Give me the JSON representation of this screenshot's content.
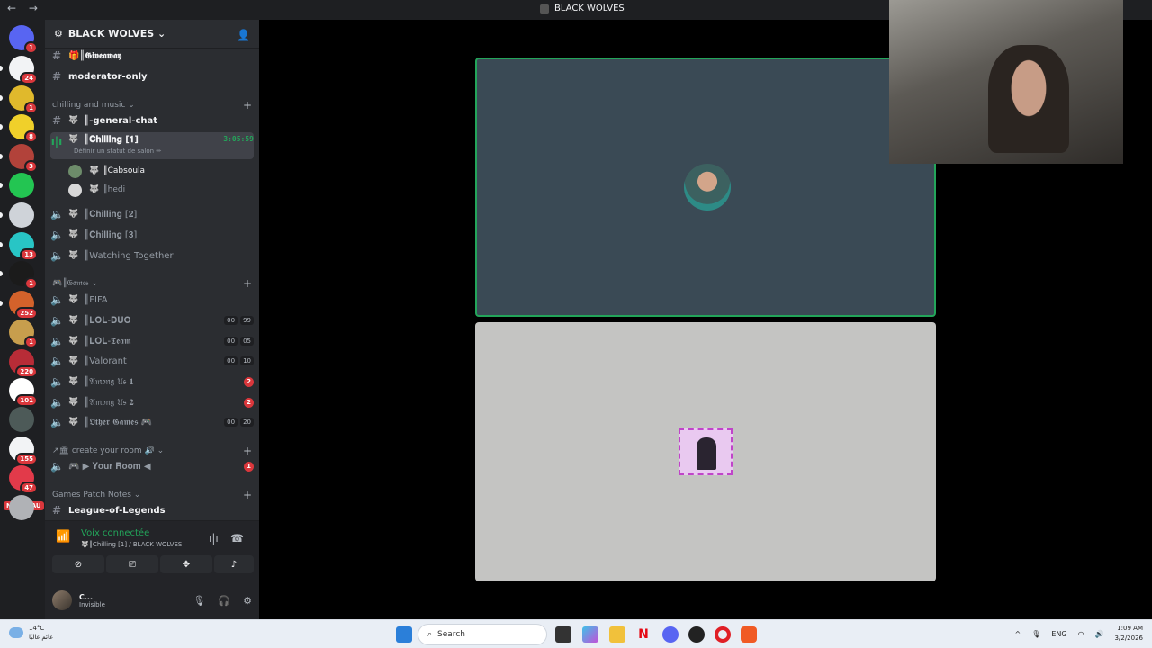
{
  "window": {
    "title": "BLACK WOLVES",
    "back": "←",
    "forward": "→"
  },
  "server": {
    "name": "BLACK WOLVES ⌄"
  },
  "guilds": [
    {
      "badge": "1",
      "color": "#5865f2"
    },
    {
      "badge": "24",
      "color": "#f2f3f5"
    },
    {
      "badge": "1",
      "color": "#e0b92c"
    },
    {
      "badge": "8",
      "color": "#f0d02a"
    },
    {
      "badge": "3",
      "color": "#b2423a"
    },
    {
      "badge": "",
      "color": "#23c552"
    },
    {
      "badge": "",
      "color": "#cfd3d9"
    },
    {
      "badge": "13",
      "color": "#28c5c5"
    },
    {
      "badge": "1",
      "color": "#1b1b1b"
    },
    {
      "badge": "252",
      "color": "#d3622b"
    },
    {
      "badge": "1",
      "color": "#c79e4d"
    },
    {
      "badge": "220",
      "color": "#b82c37"
    },
    {
      "badge": "101",
      "color": "#ffffff"
    },
    {
      "badge": "",
      "color": "#4d5a58"
    },
    {
      "badge": "155",
      "color": "#f2f3f5"
    },
    {
      "badge": "47",
      "color": "#e23a4a"
    },
    {
      "badge": "",
      "color": "#b0b2b6"
    }
  ],
  "new_label": "NOUVEAU",
  "channels": {
    "giveaway": "🎁║𝕲𝖎𝖛𝖊𝖆𝖜𝖆𝖞",
    "moderator": "moderator-only",
    "cat_chill": "chilling and music ⌄",
    "general": "║-general-chat",
    "chilling1": "║𝐂𝐡𝐢𝐥𝐥𝐢𝐧𝐠 [𝟏]",
    "chilling1_timer": "3:05:59",
    "chilling1_status": "Définir un statut de salon ✏",
    "member1": "║Cabsoula",
    "member2": "║hedi",
    "chilling2": "║𝐂𝐡𝐢𝐥𝐥𝐢𝐧𝐠 [𝟐]",
    "chilling3": "║𝐂𝐡𝐢𝐥𝐥𝐢𝐧𝐠 [𝟑]",
    "watching": "║Watching Together",
    "cat_games": "🎮║𝔊𝔞𝔪𝔢𝔰 ⌄",
    "fifa": "║FIFA",
    "lolduo": "║𝐋𝐎𝐋-𝐃𝐔𝐎",
    "lolduo_a": "00",
    "lolduo_b": "99",
    "lolteam": "║𝐋𝐎𝐋-𝕿𝖊𝖆𝖒",
    "lolteam_a": "00",
    "lolteam_b": "05",
    "valorant": "║Valorant",
    "valorant_a": "00",
    "valorant_b": "10",
    "amongus1": "║𝔄𝔪𝔬𝔫𝔤 𝔘𝔰 𝟏",
    "amongus1_badge": "2",
    "amongus2": "║𝔄𝔪𝔬𝔫𝔤 𝔘𝔰 𝟐",
    "amongus2_badge": "2",
    "othergames": "║𝕺𝖙𝖍𝖊𝖗 𝕲𝖆𝖒𝖊𝖘 🎮",
    "othergames_a": "00",
    "othergames_b": "20",
    "cat_room": "↗🏛 create your room 🔊 ⌄",
    "yourroom": "🎮 ▶ 𝐘𝐨𝐮𝐫 𝐑𝐨𝐨𝐦 ◀",
    "yourroom_badge": "1",
    "cat_patch": "Games Patch Notes ⌄",
    "league": "League-of-Legends"
  },
  "voice": {
    "title": "Voix connectée",
    "subtitle": "🐺║Chilling [1] / BLACK WOLVES"
  },
  "user": {
    "name": "C...",
    "status": "Invisible"
  },
  "taskbar": {
    "temp": "14°C",
    "weather_text": "غائم غالبًا",
    "search_placeholder": "Search",
    "lang": "ENG",
    "time": "1:09 AM",
    "date": "3/2/2026"
  }
}
